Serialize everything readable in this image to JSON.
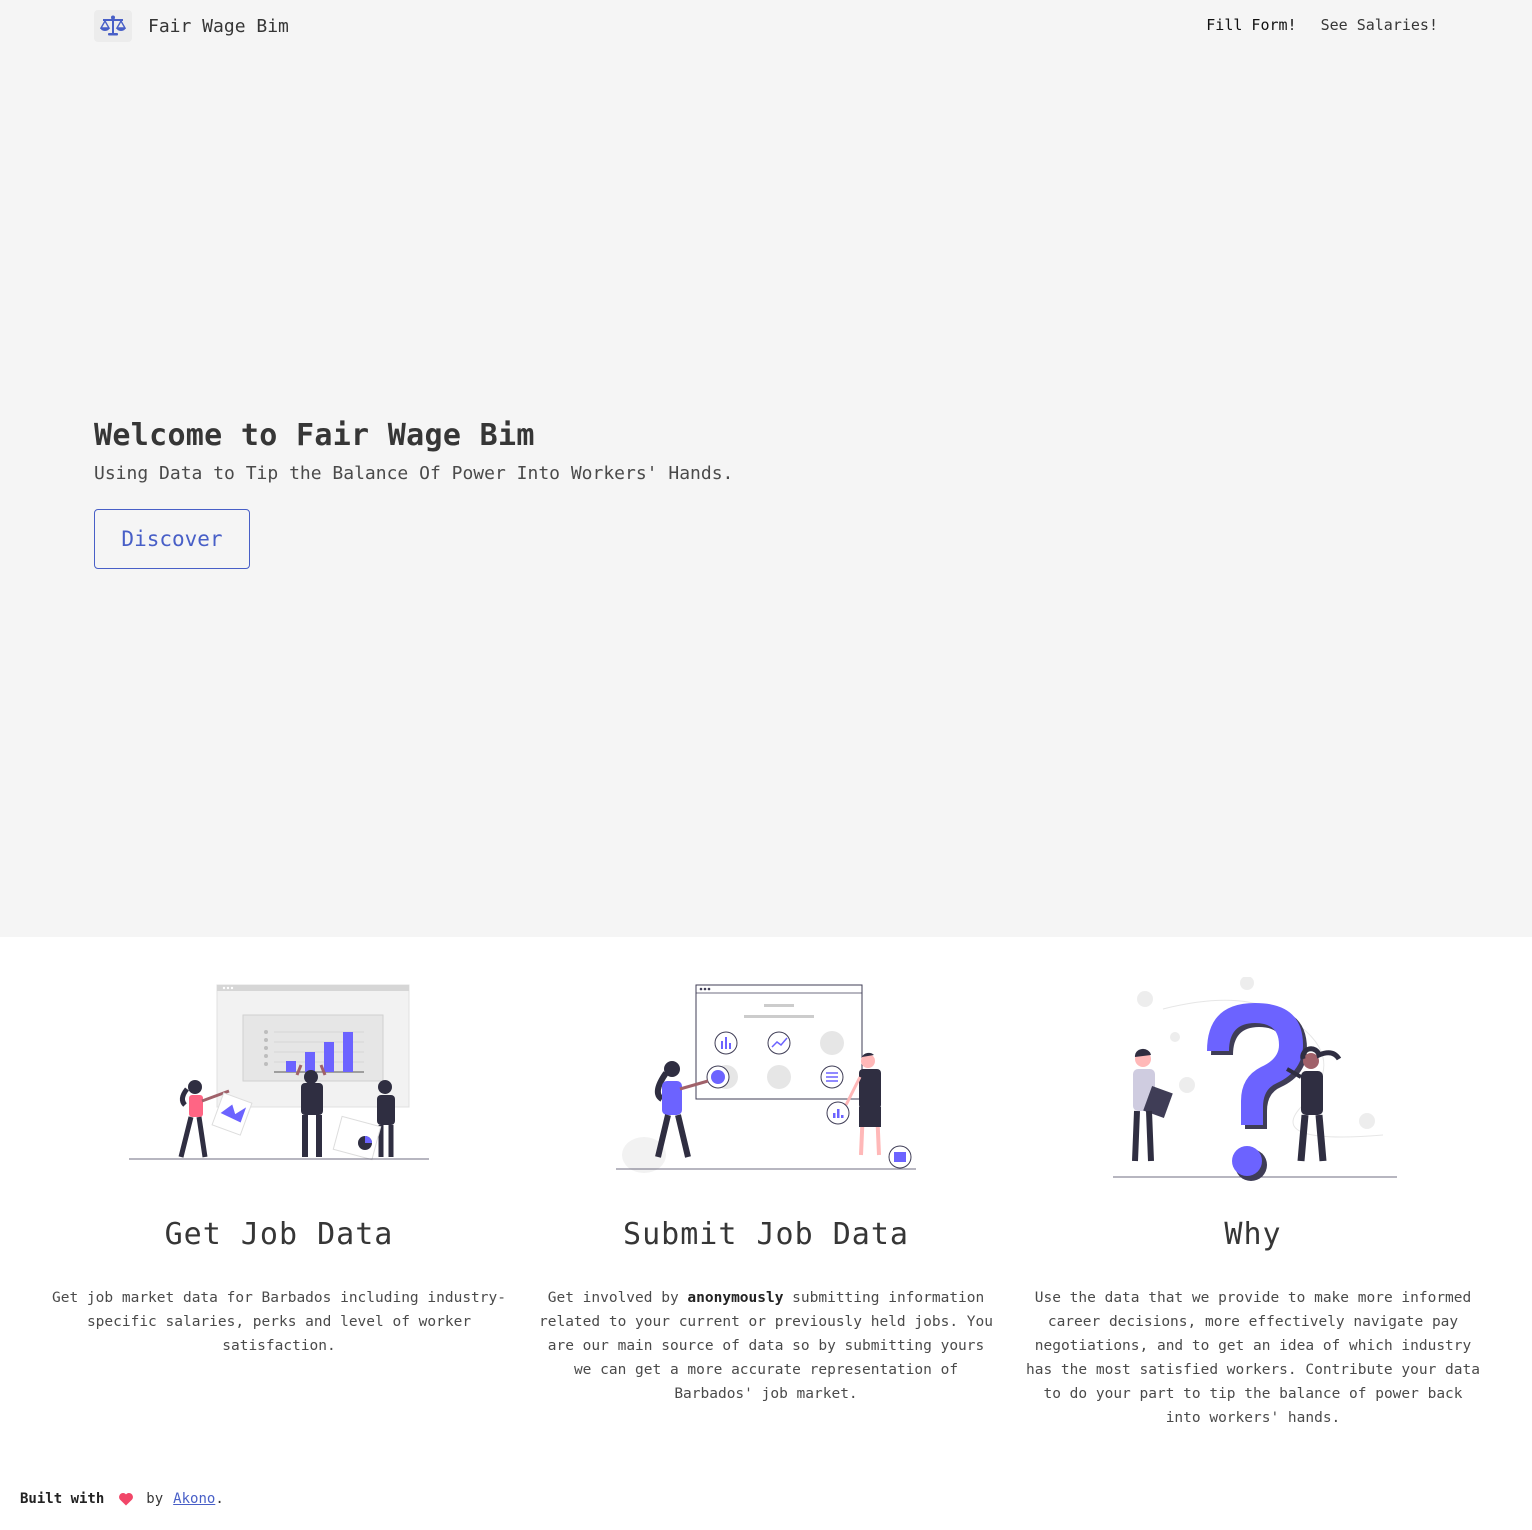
{
  "header": {
    "brand_icon": "scale-balance-icon",
    "brand_name": "Fair Wage Bim",
    "nav": [
      {
        "label": "Fill Form!"
      },
      {
        "label": "See Salaries!"
      }
    ]
  },
  "hero": {
    "title": "Welcome to Fair Wage Bim",
    "subtitle": "Using Data to Tip the Balance Of Power Into Workers' Hands.",
    "cta_label": "Discover"
  },
  "features": [
    {
      "illustration": "team-presenting-bar-chart-illustration",
      "title": "Get Job Data",
      "text": "Get job market data for Barbados including industry-specific salaries, perks and level of worker satisfaction."
    },
    {
      "illustration": "people-using-dashboard-illustration",
      "title": "Submit Job Data",
      "text_before": "Get involved by ",
      "text_strong": "anonymously",
      "text_after": " submitting information related to your current or previously held jobs. You are our main source of data so by submitting yours we can get a more accurate representation of Barbados' job market."
    },
    {
      "illustration": "people-with-question-mark-illustration",
      "title": "Why",
      "text": "Use the data that we provide to make more informed career decisions, more effectively navigate pay negotiations, and to get an idea of which industry has the most satisfied workers. Contribute your data to do your part to tip the balance of power back into workers' hands."
    }
  ],
  "footer": {
    "built_with": "Built with",
    "heart_icon": "heart-icon",
    "by": "by",
    "author_link": "Akono",
    "period": "."
  },
  "colors": {
    "accent": "#485fc7",
    "illustration_purple": "#6c63ff",
    "heart": "#f14668",
    "hero_bg": "#f5f5f5"
  }
}
